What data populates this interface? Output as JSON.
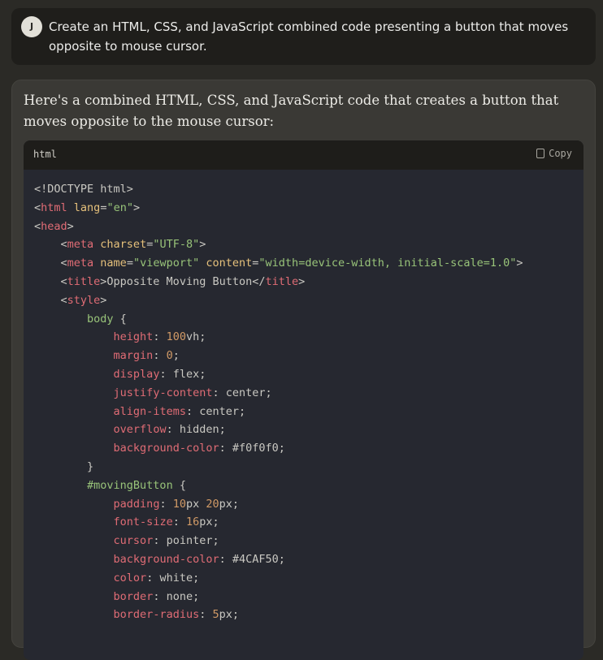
{
  "user": {
    "avatar_initial": "J",
    "message": "Create an HTML, CSS, and JavaScript combined code presenting a button that moves opposite to mouse cursor."
  },
  "assistant": {
    "intro": "Here's a combined HTML, CSS, and JavaScript code that creates a button that moves opposite to the mouse cursor:",
    "code_block": {
      "language": "html",
      "copy_label": "Copy",
      "lines": [
        [
          {
            "t": "plain",
            "v": "<!DOCTYPE html>"
          }
        ],
        [
          {
            "t": "plain",
            "v": "<"
          },
          {
            "t": "tag",
            "v": "html"
          },
          {
            "t": "plain",
            "v": " "
          },
          {
            "t": "attr",
            "v": "lang"
          },
          {
            "t": "plain",
            "v": "="
          },
          {
            "t": "str",
            "v": "\"en\""
          },
          {
            "t": "plain",
            "v": ">"
          }
        ],
        [
          {
            "t": "plain",
            "v": "<"
          },
          {
            "t": "tag",
            "v": "head"
          },
          {
            "t": "plain",
            "v": ">"
          }
        ],
        [
          {
            "t": "plain",
            "v": "    <"
          },
          {
            "t": "tag",
            "v": "meta"
          },
          {
            "t": "plain",
            "v": " "
          },
          {
            "t": "attr",
            "v": "charset"
          },
          {
            "t": "plain",
            "v": "="
          },
          {
            "t": "str",
            "v": "\"UTF-8\""
          },
          {
            "t": "plain",
            "v": ">"
          }
        ],
        [
          {
            "t": "plain",
            "v": "    <"
          },
          {
            "t": "tag",
            "v": "meta"
          },
          {
            "t": "plain",
            "v": " "
          },
          {
            "t": "attr",
            "v": "name"
          },
          {
            "t": "plain",
            "v": "="
          },
          {
            "t": "str",
            "v": "\"viewport\""
          },
          {
            "t": "plain",
            "v": " "
          },
          {
            "t": "attr",
            "v": "content"
          },
          {
            "t": "plain",
            "v": "="
          },
          {
            "t": "str",
            "v": "\"width=device-width, initial-scale=1.0\""
          },
          {
            "t": "plain",
            "v": ">"
          }
        ],
        [
          {
            "t": "plain",
            "v": "    <"
          },
          {
            "t": "tag",
            "v": "title"
          },
          {
            "t": "plain",
            "v": ">Opposite Moving Button</"
          },
          {
            "t": "tag",
            "v": "title"
          },
          {
            "t": "plain",
            "v": ">"
          }
        ],
        [
          {
            "t": "plain",
            "v": "    <"
          },
          {
            "t": "tag",
            "v": "style"
          },
          {
            "t": "plain",
            "v": ">"
          }
        ],
        [
          {
            "t": "plain",
            "v": "        "
          },
          {
            "t": "sel",
            "v": "body"
          },
          {
            "t": "plain",
            "v": " {"
          }
        ],
        [
          {
            "t": "plain",
            "v": "            "
          },
          {
            "t": "prop",
            "v": "height"
          },
          {
            "t": "plain",
            "v": ": "
          },
          {
            "t": "num",
            "v": "100"
          },
          {
            "t": "plain",
            "v": "vh;"
          }
        ],
        [
          {
            "t": "plain",
            "v": "            "
          },
          {
            "t": "prop",
            "v": "margin"
          },
          {
            "t": "plain",
            "v": ": "
          },
          {
            "t": "num",
            "v": "0"
          },
          {
            "t": "plain",
            "v": ";"
          }
        ],
        [
          {
            "t": "plain",
            "v": "            "
          },
          {
            "t": "prop",
            "v": "display"
          },
          {
            "t": "plain",
            "v": ": flex;"
          }
        ],
        [
          {
            "t": "plain",
            "v": "            "
          },
          {
            "t": "prop",
            "v": "justify-content"
          },
          {
            "t": "plain",
            "v": ": center;"
          }
        ],
        [
          {
            "t": "plain",
            "v": "            "
          },
          {
            "t": "prop",
            "v": "align-items"
          },
          {
            "t": "plain",
            "v": ": center;"
          }
        ],
        [
          {
            "t": "plain",
            "v": "            "
          },
          {
            "t": "prop",
            "v": "overflow"
          },
          {
            "t": "plain",
            "v": ": hidden;"
          }
        ],
        [
          {
            "t": "plain",
            "v": "            "
          },
          {
            "t": "prop",
            "v": "background-color"
          },
          {
            "t": "plain",
            "v": ": #f0f0f0;"
          }
        ],
        [
          {
            "t": "plain",
            "v": "        }"
          }
        ],
        [
          {
            "t": "plain",
            "v": "        "
          },
          {
            "t": "sel",
            "v": "#movingButton"
          },
          {
            "t": "plain",
            "v": " {"
          }
        ],
        [
          {
            "t": "plain",
            "v": "            "
          },
          {
            "t": "prop",
            "v": "padding"
          },
          {
            "t": "plain",
            "v": ": "
          },
          {
            "t": "num",
            "v": "10"
          },
          {
            "t": "plain",
            "v": "px "
          },
          {
            "t": "num",
            "v": "20"
          },
          {
            "t": "plain",
            "v": "px;"
          }
        ],
        [
          {
            "t": "plain",
            "v": "            "
          },
          {
            "t": "prop",
            "v": "font-size"
          },
          {
            "t": "plain",
            "v": ": "
          },
          {
            "t": "num",
            "v": "16"
          },
          {
            "t": "plain",
            "v": "px;"
          }
        ],
        [
          {
            "t": "plain",
            "v": "            "
          },
          {
            "t": "prop",
            "v": "cursor"
          },
          {
            "t": "plain",
            "v": ": pointer;"
          }
        ],
        [
          {
            "t": "plain",
            "v": "            "
          },
          {
            "t": "prop",
            "v": "background-color"
          },
          {
            "t": "plain",
            "v": ": #4CAF50;"
          }
        ],
        [
          {
            "t": "plain",
            "v": "            "
          },
          {
            "t": "prop",
            "v": "color"
          },
          {
            "t": "plain",
            "v": ": white;"
          }
        ],
        [
          {
            "t": "plain",
            "v": "            "
          },
          {
            "t": "prop",
            "v": "border"
          },
          {
            "t": "plain",
            "v": ": none;"
          }
        ],
        [
          {
            "t": "plain",
            "v": "            "
          },
          {
            "t": "prop",
            "v": "border-radius"
          },
          {
            "t": "plain",
            "v": ": "
          },
          {
            "t": "num",
            "v": "5"
          },
          {
            "t": "plain",
            "v": "px;"
          }
        ]
      ]
    }
  }
}
